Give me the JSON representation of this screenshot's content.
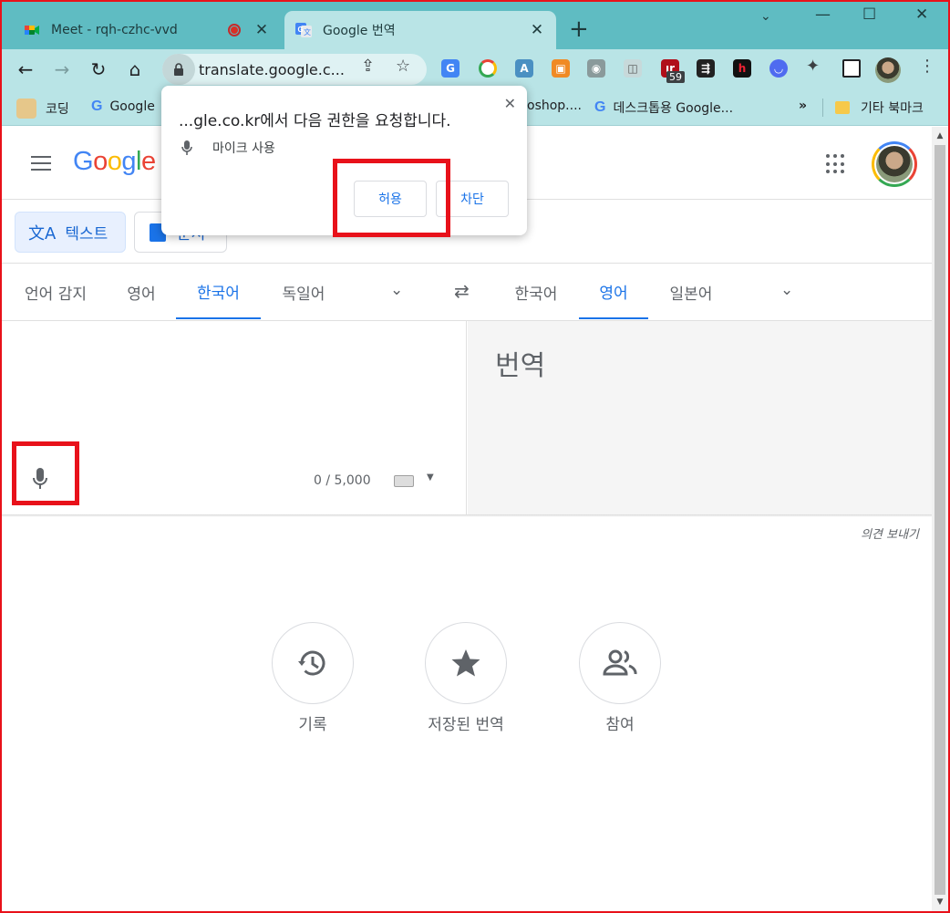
{
  "browser": {
    "tabs": [
      {
        "title": "Meet - rqh-czhc-vvd",
        "active": false,
        "recording": true
      },
      {
        "title": "Google 번역",
        "active": true
      }
    ],
    "url": "translate.google.c...",
    "extension_badge": "59",
    "bookmarks": [
      {
        "label": "코딩"
      },
      {
        "label": "Google"
      },
      {
        "label": "oshop...."
      },
      {
        "label": "데스크톱용 Google..."
      },
      {
        "label": "»"
      },
      {
        "label": "기타 북마크"
      }
    ]
  },
  "translate": {
    "logo": "Google",
    "modes": {
      "text": "텍스트",
      "document": "문서"
    },
    "source_languages": [
      "언어 감지",
      "영어",
      "한국어",
      "독일어"
    ],
    "source_active": "한국어",
    "target_languages": [
      "한국어",
      "영어",
      "일본어"
    ],
    "target_active": "영어",
    "translation_placeholder": "번역",
    "char_counter": "0 / 5,000",
    "feedback": "의견 보내기",
    "actions": [
      {
        "label": "기록",
        "icon": "history-icon"
      },
      {
        "label": "저장된 번역",
        "icon": "star-icon"
      },
      {
        "label": "참여",
        "icon": "people-icon"
      }
    ]
  },
  "permission_popup": {
    "title": "...gle.co.kr에서 다음 권한을 요청합니다.",
    "permission": "마이크 사용",
    "allow_label": "허용",
    "block_label": "차단"
  },
  "colors": {
    "tab_strip": "#5fbcc2",
    "toolbar": "#b9e4e6",
    "accent": "#1a73e8",
    "highlight": "#e8111a"
  }
}
